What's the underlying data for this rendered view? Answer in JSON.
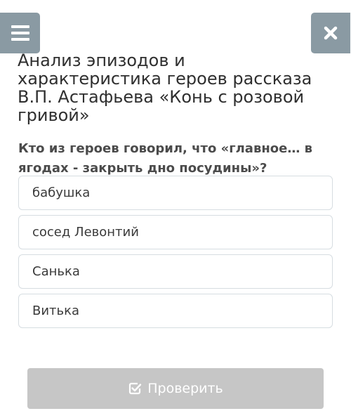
{
  "header": {
    "menu_icon": "hamburger-menu-icon",
    "close_icon": "close-icon",
    "title": "Анализ эпизодов и характеристика героев рассказа В.П. Астафьева «Конь с розовой гривой»"
  },
  "question": {
    "text": "Кто из героев говорил, что «главное… в ягодах - закрыть дно посудины»?",
    "options": [
      {
        "label": "бабушка"
      },
      {
        "label": "сосед Левонтий"
      },
      {
        "label": "Санька"
      },
      {
        "label": "Витька"
      }
    ]
  },
  "submit": {
    "icon": "check-square-icon",
    "label": "Проверить"
  }
}
